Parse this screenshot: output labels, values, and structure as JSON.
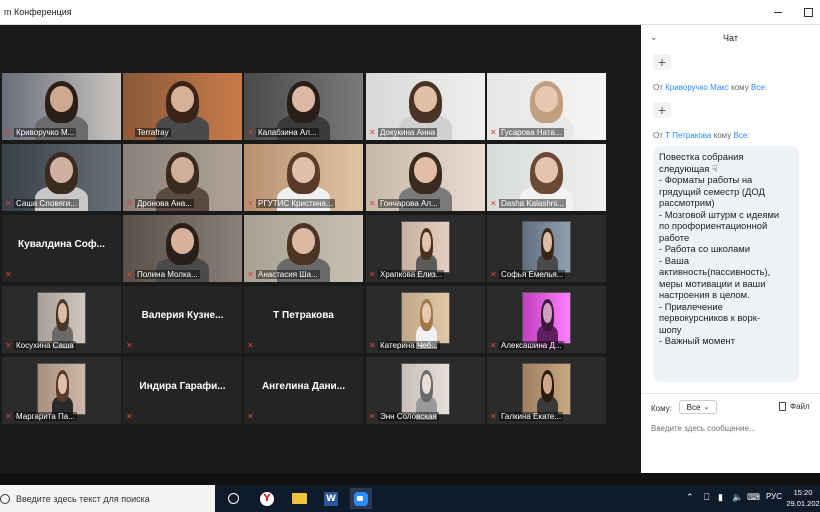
{
  "window": {
    "title": "m Конференция"
  },
  "tiles": [
    {
      "name": "Криворучко М...",
      "type": "video",
      "scene": 0
    },
    {
      "name": "Terrafray",
      "type": "video",
      "scene": 1
    },
    {
      "name": "Калабзина Ал...",
      "type": "video",
      "scene": 2
    },
    {
      "name": "Докукина Анна",
      "type": "video",
      "scene": 3
    },
    {
      "name": "Гусарова Ната...",
      "type": "video",
      "scene": 4
    },
    {
      "name": "Саша Словяги...",
      "type": "video",
      "scene": 5
    },
    {
      "name": "Дронова  Ана...",
      "type": "video",
      "scene": 6
    },
    {
      "name": "РГУТИС  Кристина...",
      "type": "video",
      "scene": 7,
      "active": true
    },
    {
      "name": "Гончарова Ал...",
      "type": "video",
      "scene": 8
    },
    {
      "name": "Dasha Kalashni...",
      "type": "video",
      "scene": 9
    },
    {
      "name": "",
      "type": "name",
      "big": "Кувалдина  Соф..."
    },
    {
      "name": "Полина Молка...",
      "type": "video",
      "scene": 10
    },
    {
      "name": "Анастасия Ша...",
      "type": "video",
      "scene": 11
    },
    {
      "name": "Храпкова Елиз...",
      "type": "inset",
      "scene": 12
    },
    {
      "name": "Софья Емелья...",
      "type": "inset",
      "scene": 13
    },
    {
      "name": "Косухина Саша",
      "type": "inset",
      "scene": 14
    },
    {
      "name": "",
      "type": "name",
      "big": "Валерия  Кузне..."
    },
    {
      "name": "",
      "type": "name",
      "big": "Т Петракова"
    },
    {
      "name": "Катерина Чеб...",
      "type": "inset",
      "scene": 15
    },
    {
      "name": "Алексашина Д...",
      "type": "inset",
      "scene": 16
    },
    {
      "name": "Маргарита Па...",
      "type": "inset",
      "scene": 17
    },
    {
      "name": "",
      "type": "name",
      "big": "Индира  Гарафи..."
    },
    {
      "name": "",
      "type": "name",
      "big": "Ангелина  Дани..."
    },
    {
      "name": "Энн Соловская",
      "type": "inset",
      "scene": 18
    },
    {
      "name": "Галкина Екате...",
      "type": "inset",
      "scene": 19
    }
  ],
  "chat": {
    "title": "Чат",
    "msg1": {
      "from": "От",
      "sender": "Криворучко Макс",
      "to": "кому",
      "recipient": "Все:"
    },
    "msg2": {
      "from": "От",
      "sender": "Т Петракова",
      "to": "кому",
      "recipient": "Все:"
    },
    "message_lines": [
      "Повестка собрания",
      "следующая ☟",
      "- Форматы работы на",
      "грядущий семестр (ДОД",
      "рассмотрим)",
      "- Мозговой штурм с идеями",
      "по профориентационной",
      "работе",
      "- Работа со школами",
      "- Ваша",
      "активность(пассивность),",
      "меры мотивации и ваши",
      "настроения в целом.",
      "- Привлечение",
      "первокурсников к ворк-",
      "шопу",
      "- Важный момент"
    ],
    "to_label": "Кому:",
    "to_value": "Все",
    "file_label": "Файл",
    "input_placeholder": "Введите здесь сообщение..."
  },
  "taskbar": {
    "search_placeholder": "Введите здесь текст для поиска",
    "language": "РУС",
    "time": "15:20",
    "date": "29.01.202"
  },
  "colors": {
    "accent": "#2d8cff",
    "active_speaker": "#c8e36a",
    "mic_muted": "#e0413a"
  }
}
